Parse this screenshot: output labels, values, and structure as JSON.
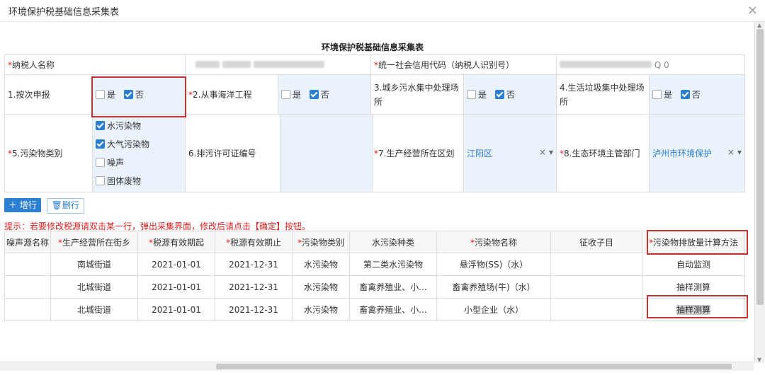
{
  "dialog": {
    "title": "环境保护税基础信息采集表",
    "close": "×"
  },
  "form": {
    "title": "环境保护税基础信息采集表",
    "taxpayer_name_label": "纳税人名称",
    "credit_code_label": "统一社会信用代码（纳税人识别号）",
    "credit_code_tail": "Q 0",
    "q1_label": "1.按次申报",
    "q2_label": "2.从事海洋工程",
    "q3_label": "3.城乡污水集中处理场所",
    "q4_label": "4.生活垃圾集中处理场所",
    "yes": "是",
    "no": "否",
    "pollutant_type_label": "5.污染物类别",
    "pollutant_options": [
      "水污染物",
      "大气污染物",
      "噪声",
      "固体废物"
    ],
    "permit_label": "6.排污许可证编号",
    "district_label": "7.生产经营所在区划",
    "district_value": "江阳区",
    "eco_dept_label": "8.生态环境主管部门",
    "eco_dept_value": "泸州市环境保护",
    "clear": "×",
    "caret": "▾"
  },
  "buttons": {
    "add": "增行",
    "delete": "删行"
  },
  "hint": "提示：若要修改税源请双击某一行，弹出采集界面，修改后请点击【确定】按钮。",
  "grid": {
    "headers": [
      "噪声源名称",
      "生产经营所在街乡",
      "税源有效期起",
      "税源有效期止",
      "污染物类别",
      "水污染种类",
      "污染物名称",
      "征收子目",
      "污染物排放量计算方法"
    ],
    "required": [
      false,
      true,
      true,
      true,
      true,
      false,
      true,
      false,
      true
    ],
    "rows": [
      [
        "",
        "南城街道",
        "2021-01-01",
        "2021-12-31",
        "水污染物",
        "第二类水污染物",
        "悬浮物(SS)（水）",
        "",
        "自动监测"
      ],
      [
        "",
        "北城街道",
        "2021-01-01",
        "2021-12-31",
        "水污染物",
        "畜禽养殖业、小...",
        "畜禽养殖场(牛)（水）",
        "",
        "抽样测算"
      ],
      [
        "",
        "北城街道",
        "2021-01-01",
        "2021-12-31",
        "水污染物",
        "畜禽养殖业、小...",
        "小型企业（水）",
        "",
        "抽样测算"
      ]
    ]
  },
  "colors": {
    "accent": "#2b7fd1",
    "required": "#e02020",
    "highlight_box": "#c83232"
  }
}
